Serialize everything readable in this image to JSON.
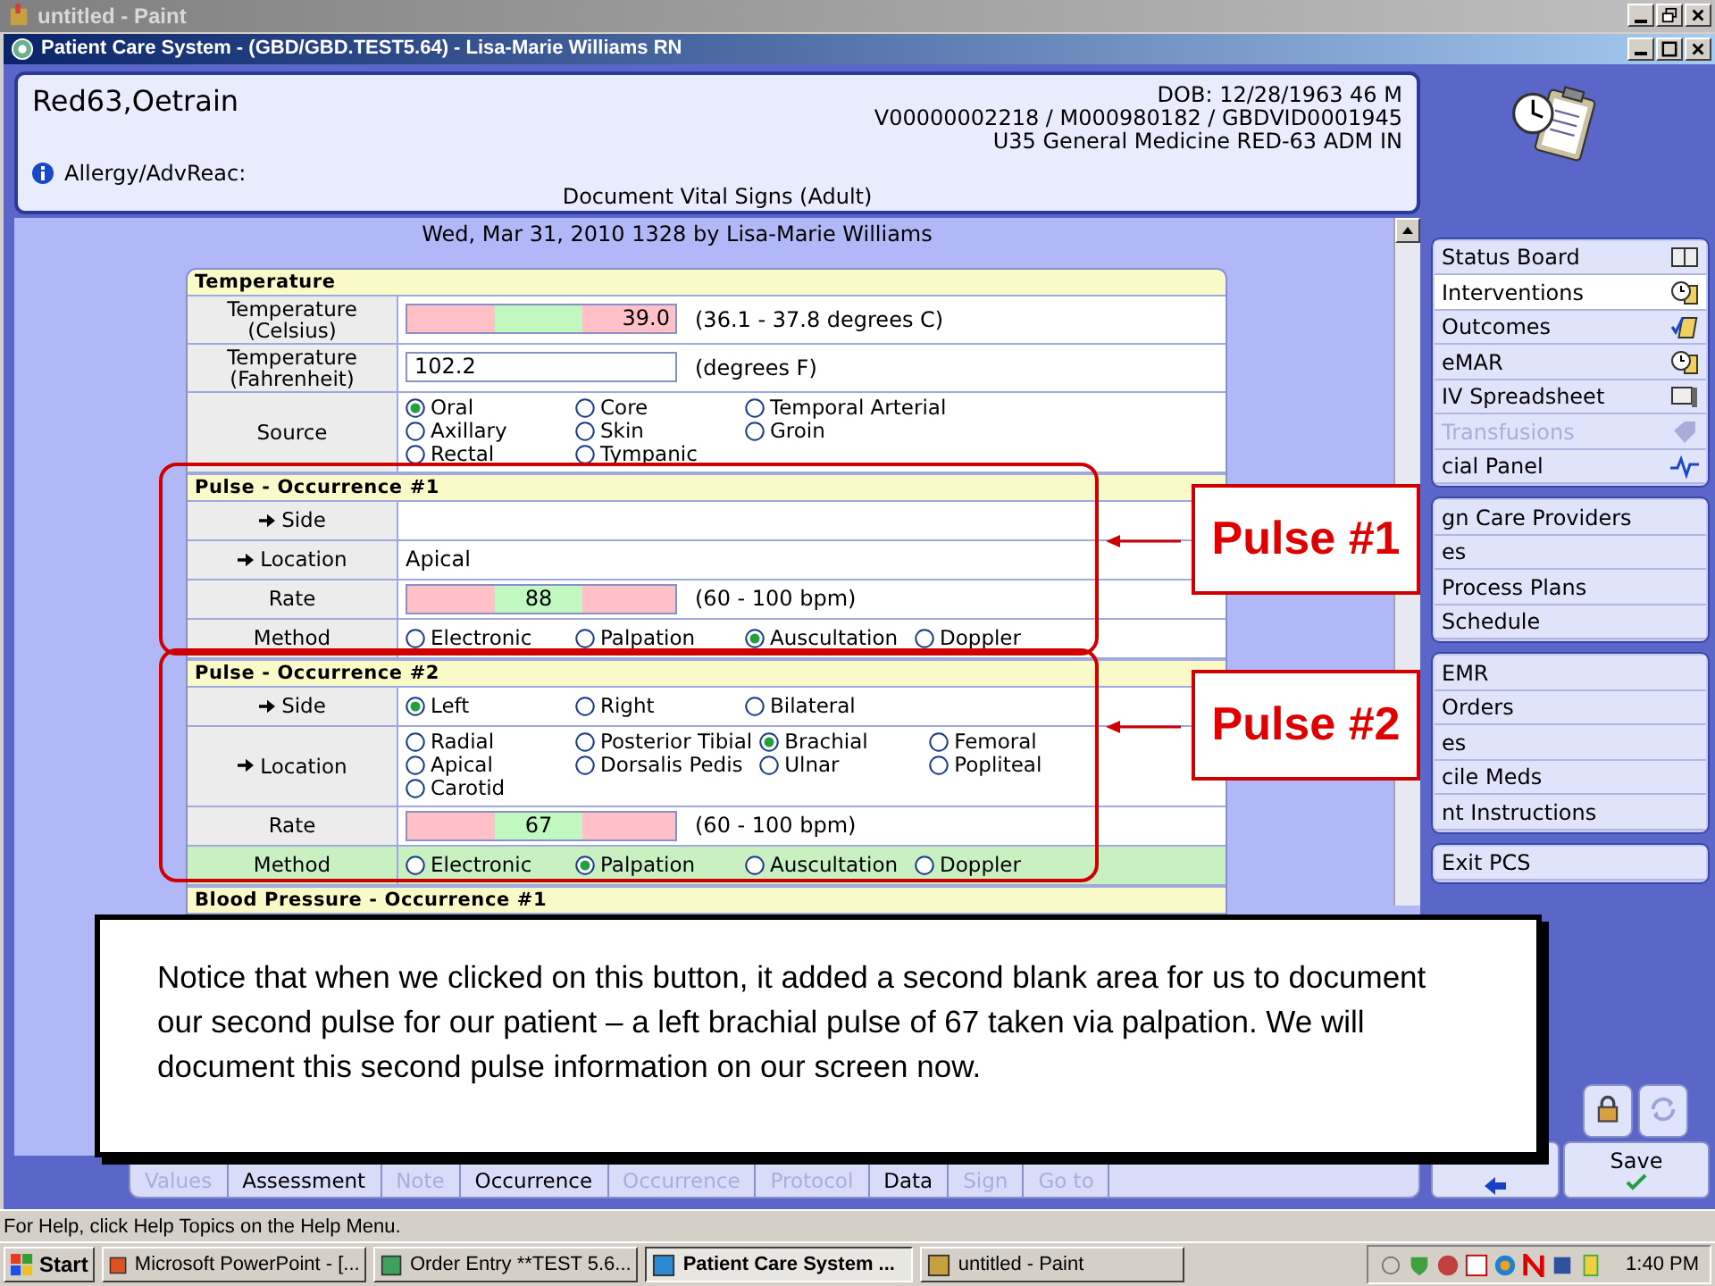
{
  "paint_window": {
    "title": "untitled - Paint"
  },
  "app_window": {
    "title": "Patient Care System - (GBD/GBD.TEST5.64) - Lisa-Marie Williams RN"
  },
  "patient": {
    "name": "Red63,Oetrain",
    "dob": "DOB: 12/28/1963 46 M",
    "ids": "V00000002218 / M000980182 / GBDVID0001945",
    "unit": "U35 General Medicine  RED-63  ADM IN",
    "allergy": "Allergy/AdvReac:",
    "document": "Document Vital Signs (Adult)"
  },
  "entry_line": "Wed,  Mar 31, 2010 1328  by  Lisa-Marie Williams",
  "sections": [
    {
      "title": "Temperature",
      "rows": [
        {
          "label": "Temperature (Celsius)",
          "arrow": false,
          "kind": "range",
          "value": "39.0",
          "out_of_range": true,
          "hint": "(36.1 - 37.8 degrees C)"
        },
        {
          "label": "Temperature (Fahrenheit)",
          "arrow": false,
          "kind": "input",
          "value": "102.2",
          "hint": "(degrees F)"
        },
        {
          "label": "Source",
          "arrow": false,
          "kind": "radio",
          "options": [
            {
              "label": "Oral",
              "selected": true
            },
            {
              "label": "Core",
              "selected": false
            },
            {
              "label": "Temporal Arterial",
              "selected": false
            },
            {
              "label": "Axillary",
              "selected": false
            },
            {
              "label": "Skin",
              "selected": false
            },
            {
              "label": "Groin",
              "selected": false
            },
            {
              "label": "Rectal",
              "selected": false
            },
            {
              "label": "Tympanic",
              "selected": false
            }
          ]
        }
      ]
    },
    {
      "title": "Pulse - Occurrence #1",
      "callout": "Pulse #1",
      "rows": [
        {
          "label": "Side",
          "arrow": true,
          "kind": "blank"
        },
        {
          "label": "Location",
          "arrow": true,
          "kind": "text",
          "value": "Apical"
        },
        {
          "label": "Rate",
          "arrow": false,
          "kind": "range",
          "value": "88",
          "out_of_range": false,
          "hint": "(60 - 100 bpm)"
        },
        {
          "label": "Method",
          "arrow": false,
          "kind": "radio",
          "options": [
            {
              "label": "Electronic",
              "selected": false
            },
            {
              "label": "Palpation",
              "selected": false
            },
            {
              "label": "Auscultation",
              "selected": true
            },
            {
              "label": "Doppler",
              "selected": false
            }
          ]
        }
      ]
    },
    {
      "title": "Pulse - Occurrence #2",
      "callout": "Pulse #2",
      "rows": [
        {
          "label": "Side",
          "arrow": true,
          "kind": "radio",
          "options": [
            {
              "label": "Left",
              "selected": true
            },
            {
              "label": "Right",
              "selected": false
            },
            {
              "label": "Bilateral",
              "selected": false
            }
          ]
        },
        {
          "label": "Location",
          "arrow": true,
          "kind": "radio",
          "options": [
            {
              "label": "Radial",
              "selected": false
            },
            {
              "label": "Posterior Tibial",
              "selected": false
            },
            {
              "label": "Brachial",
              "selected": true
            },
            {
              "label": "Femoral",
              "selected": false
            },
            {
              "label": "Apical",
              "selected": false
            },
            {
              "label": "Dorsalis Pedis",
              "selected": false
            },
            {
              "label": "Ulnar",
              "selected": false
            },
            {
              "label": "Popliteal",
              "selected": false
            },
            {
              "label": "Carotid",
              "selected": false
            }
          ]
        },
        {
          "label": "Rate",
          "arrow": false,
          "kind": "range",
          "value": "67",
          "out_of_range": false,
          "hint": "(60 - 100 bpm)"
        },
        {
          "label": "Method",
          "arrow": false,
          "highlighted": true,
          "kind": "radio",
          "options": [
            {
              "label": "Electronic",
              "selected": false
            },
            {
              "label": "Palpation",
              "selected": true
            },
            {
              "label": "Auscultation",
              "selected": false
            },
            {
              "label": "Doppler",
              "selected": false
            }
          ]
        }
      ]
    },
    {
      "title": "Blood Pressure - Occurrence #1"
    }
  ],
  "note": "Notice that when we clicked on this button, it added a second blank area for us to document our second pulse for our patient – a left brachial pulse of 67 taken via palpation. We will document this second pulse information on our screen now.",
  "bottom_tabs": [
    {
      "label": "Values",
      "disabled": true
    },
    {
      "label": "Assessment",
      "disabled": false
    },
    {
      "label": "Note",
      "disabled": true
    },
    {
      "label": "Occurrence",
      "disabled": false
    },
    {
      "label": "Occurrence",
      "disabled": true
    },
    {
      "label": "Protocol",
      "disabled": true
    },
    {
      "label": "Data",
      "disabled": false
    },
    {
      "label": "Sign",
      "disabled": true
    },
    {
      "label": "Go to",
      "disabled": true
    }
  ],
  "sidebar": {
    "groups": [
      [
        {
          "label": "Status Board",
          "selected": false,
          "disabled": false
        },
        {
          "label": "Interventions",
          "selected": true,
          "disabled": false
        },
        {
          "label": "Outcomes",
          "selected": false,
          "disabled": false
        },
        {
          "label": "eMAR",
          "selected": false,
          "disabled": false
        },
        {
          "label": "IV Spreadsheet",
          "selected": false,
          "disabled": false
        },
        {
          "label": "Transfusions",
          "selected": false,
          "disabled": true
        },
        {
          "label": "cial Panel",
          "selected": false,
          "disabled": false
        }
      ],
      [
        {
          "label": "gn Care Providers",
          "selected": false,
          "disabled": false
        },
        {
          "label": "es",
          "selected": false,
          "disabled": false
        },
        {
          "label": "Process Plans",
          "selected": false,
          "disabled": false
        },
        {
          "label": "Schedule",
          "selected": false,
          "disabled": false
        }
      ],
      [
        {
          "label": "EMR",
          "selected": false,
          "disabled": false
        },
        {
          "label": "Orders",
          "selected": false,
          "disabled": false
        },
        {
          "label": "es",
          "selected": false,
          "disabled": false
        },
        {
          "label": "cile Meds",
          "selected": false,
          "disabled": false
        },
        {
          "label": "nt Instructions",
          "selected": false,
          "disabled": false
        }
      ],
      [
        {
          "label": "Exit PCS",
          "selected": false,
          "disabled": false
        }
      ]
    ]
  },
  "save_button": "Save",
  "status_bar": "For Help, click Help Topics on the Help Menu.",
  "taskbar": {
    "start": "Start",
    "tasks": [
      {
        "label": "Microsoft PowerPoint - [...",
        "selected": false
      },
      {
        "label": "Order Entry **TEST 5.6...",
        "selected": false
      },
      {
        "label": "Patient Care System ...",
        "selected": true
      },
      {
        "label": "untitled - Paint",
        "selected": false
      }
    ],
    "clock": "1:40 PM"
  }
}
